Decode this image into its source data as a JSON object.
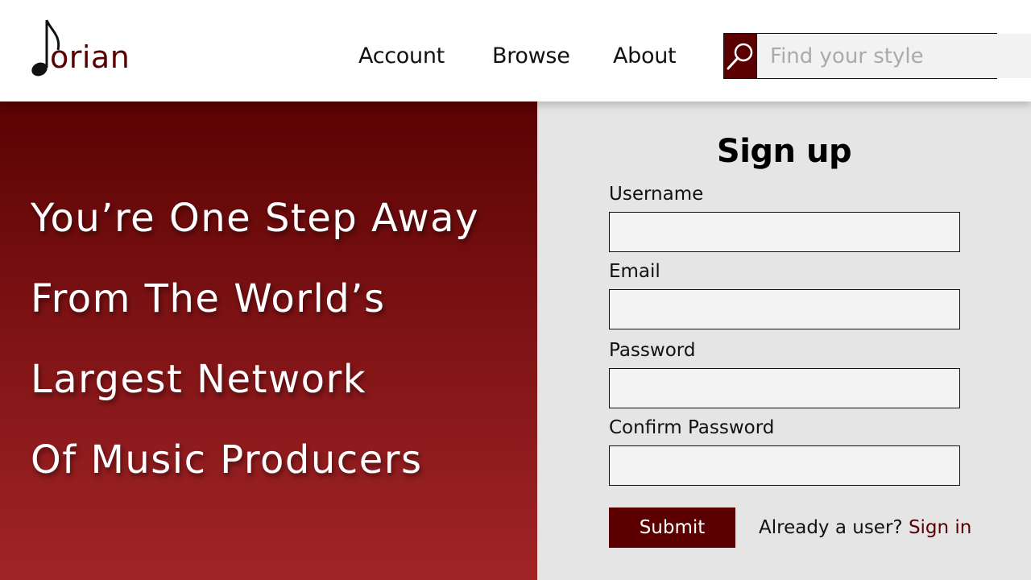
{
  "brand": {
    "logo_text": "orian",
    "accent_color": "#5a0000"
  },
  "nav": {
    "items": [
      {
        "label": "Account"
      },
      {
        "label": "Browse"
      },
      {
        "label": "About"
      }
    ]
  },
  "search": {
    "placeholder": "Find your style",
    "value": "",
    "icon": "search-icon"
  },
  "hero": {
    "lines": [
      "You’re One Step Away",
      "From The World’s",
      "Largest Network",
      "Of Music Producers"
    ]
  },
  "signup": {
    "title": "Sign up",
    "fields": [
      {
        "label": "Username",
        "value": ""
      },
      {
        "label": "Email",
        "value": ""
      },
      {
        "label": "Password",
        "value": ""
      },
      {
        "label": "Confirm Password",
        "value": ""
      }
    ],
    "submit_label": "Submit",
    "already_text": "Already a user?",
    "signin_label": "Sign in"
  }
}
